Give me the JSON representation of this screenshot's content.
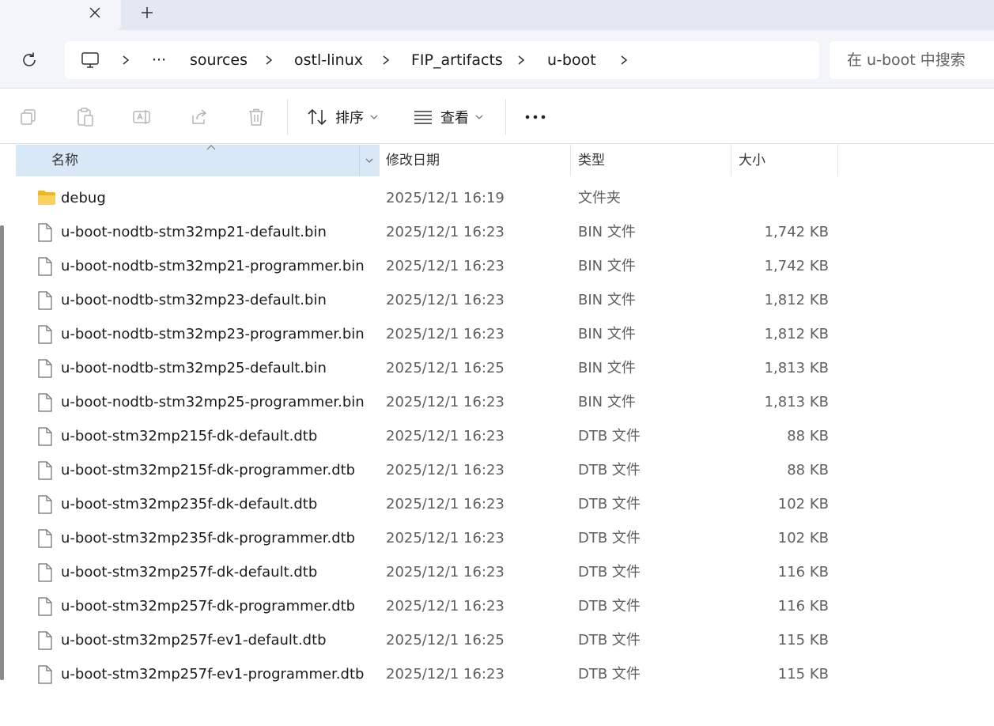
{
  "tab": {
    "close_icon": "close-icon",
    "new_icon": "plus-icon"
  },
  "nav": {
    "refresh_icon": "refresh-icon",
    "breadcrumb": [
      "sources",
      "ostl-linux",
      "FIP_artifacts",
      "u-boot"
    ],
    "overflow": "···",
    "search_placeholder": "在 u-boot 中搜索"
  },
  "commands": {
    "sort_label": "排序",
    "view_label": "查看",
    "more": "···"
  },
  "columns": {
    "name": "名称",
    "modified": "修改日期",
    "type": "类型",
    "size": "大小"
  },
  "files": [
    {
      "name": "debug",
      "date": "2025/12/1 16:19",
      "type": "文件夹",
      "size": "",
      "kind": "folder"
    },
    {
      "name": "u-boot-nodtb-stm32mp21-default.bin",
      "date": "2025/12/1 16:23",
      "type": "BIN 文件",
      "size": "1,742 KB",
      "kind": "file"
    },
    {
      "name": "u-boot-nodtb-stm32mp21-programmer.bin",
      "date": "2025/12/1 16:23",
      "type": "BIN 文件",
      "size": "1,742 KB",
      "kind": "file"
    },
    {
      "name": "u-boot-nodtb-stm32mp23-default.bin",
      "date": "2025/12/1 16:23",
      "type": "BIN 文件",
      "size": "1,812 KB",
      "kind": "file"
    },
    {
      "name": "u-boot-nodtb-stm32mp23-programmer.bin",
      "date": "2025/12/1 16:23",
      "type": "BIN 文件",
      "size": "1,812 KB",
      "kind": "file"
    },
    {
      "name": "u-boot-nodtb-stm32mp25-default.bin",
      "date": "2025/12/1 16:25",
      "type": "BIN 文件",
      "size": "1,813 KB",
      "kind": "file"
    },
    {
      "name": "u-boot-nodtb-stm32mp25-programmer.bin",
      "date": "2025/12/1 16:23",
      "type": "BIN 文件",
      "size": "1,813 KB",
      "kind": "file"
    },
    {
      "name": "u-boot-stm32mp215f-dk-default.dtb",
      "date": "2025/12/1 16:23",
      "type": "DTB 文件",
      "size": "88 KB",
      "kind": "file"
    },
    {
      "name": "u-boot-stm32mp215f-dk-programmer.dtb",
      "date": "2025/12/1 16:23",
      "type": "DTB 文件",
      "size": "88 KB",
      "kind": "file"
    },
    {
      "name": "u-boot-stm32mp235f-dk-default.dtb",
      "date": "2025/12/1 16:23",
      "type": "DTB 文件",
      "size": "102 KB",
      "kind": "file"
    },
    {
      "name": "u-boot-stm32mp235f-dk-programmer.dtb",
      "date": "2025/12/1 16:23",
      "type": "DTB 文件",
      "size": "102 KB",
      "kind": "file"
    },
    {
      "name": "u-boot-stm32mp257f-dk-default.dtb",
      "date": "2025/12/1 16:23",
      "type": "DTB 文件",
      "size": "116 KB",
      "kind": "file"
    },
    {
      "name": "u-boot-stm32mp257f-dk-programmer.dtb",
      "date": "2025/12/1 16:23",
      "type": "DTB 文件",
      "size": "116 KB",
      "kind": "file"
    },
    {
      "name": "u-boot-stm32mp257f-ev1-default.dtb",
      "date": "2025/12/1 16:25",
      "type": "DTB 文件",
      "size": "115 KB",
      "kind": "file"
    },
    {
      "name": "u-boot-stm32mp257f-ev1-programmer.dtb",
      "date": "2025/12/1 16:23",
      "type": "DTB 文件",
      "size": "115 KB",
      "kind": "file"
    }
  ],
  "colors": {
    "accent": "#d9e8f7",
    "folder": "#f5c342",
    "chrome": "#f3f5fa"
  }
}
